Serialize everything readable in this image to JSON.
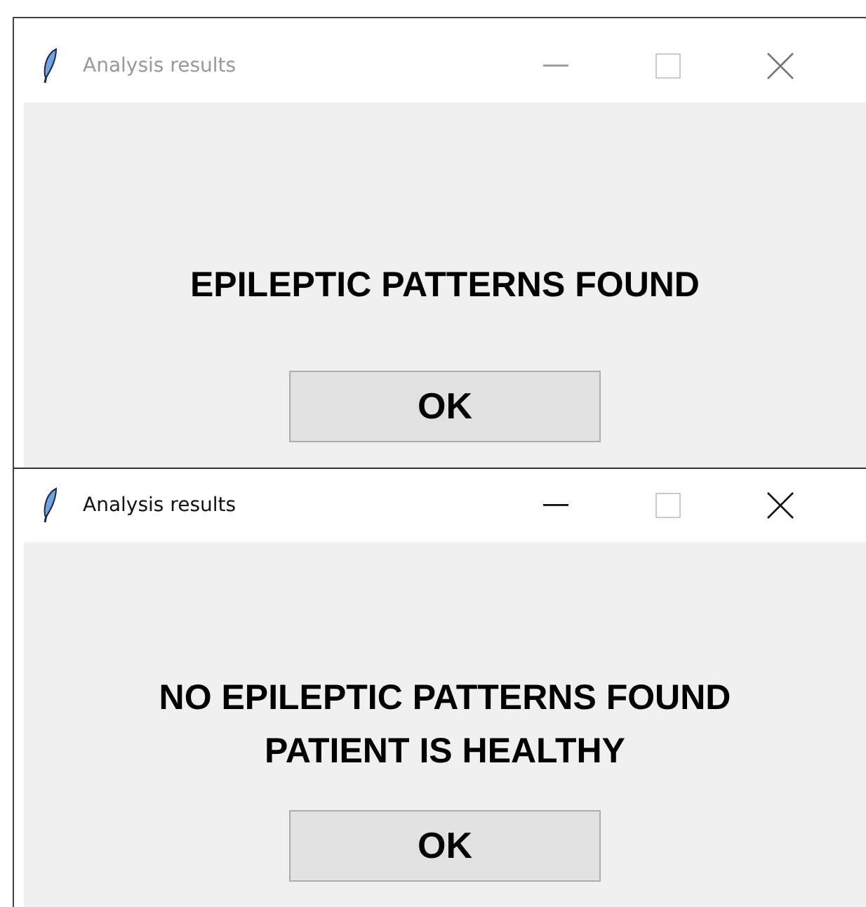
{
  "windows": [
    {
      "title": "Analysis results",
      "active": false,
      "maximize_disabled": true,
      "message_lines": [
        "EPILEPTIC PATTERNS FOUND"
      ],
      "button": "OK"
    },
    {
      "title": "Analysis results",
      "active": true,
      "maximize_disabled": true,
      "message_lines": [
        "NO EPILEPTIC PATTERNS FOUND",
        "PATIENT IS HEALTHY"
      ],
      "button": "OK"
    }
  ]
}
